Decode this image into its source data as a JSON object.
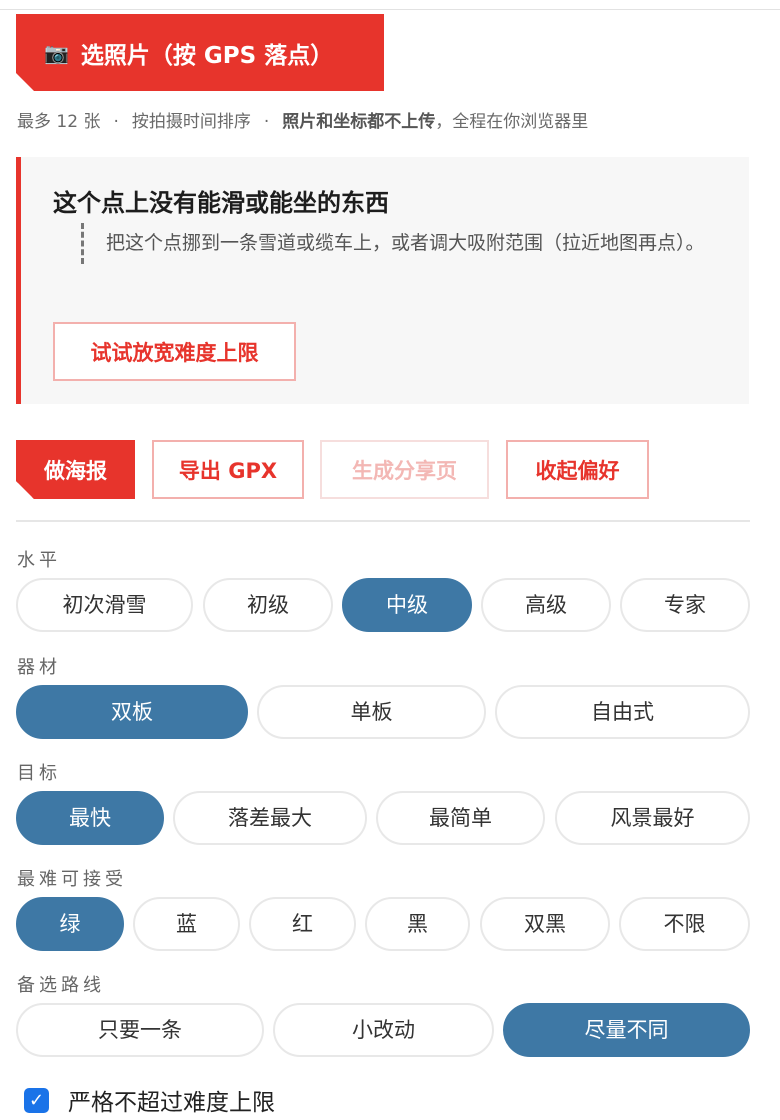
{
  "pick_photos": {
    "icon": "camera-icon",
    "icon_glyph": "📷",
    "label": "选照片（按 GPS 落点）"
  },
  "hint": {
    "limit": "最多 12 张",
    "sort": "按拍摄时间排序",
    "privacy_bold": "照片和坐标都不上传",
    "privacy_rest": "，全程在你浏览器里"
  },
  "warning": {
    "title": "这个点上没有能滑或能坐的东西",
    "body": "把这个点挪到一条雪道或缆车上，或者调大吸附范围（拉近地图再点）。",
    "action": "试试放宽难度上限"
  },
  "actions": {
    "poster": "做海报",
    "export_gpx": "导出 GPX",
    "share_page": "生成分享页",
    "collapse_prefs": "收起偏好"
  },
  "groups": {
    "level": {
      "label": "水平",
      "options": [
        "初次滑雪",
        "初级",
        "中级",
        "高级",
        "专家"
      ],
      "selected": "中级"
    },
    "gear": {
      "label": "器材",
      "options": [
        "双板",
        "单板",
        "自由式"
      ],
      "selected": "双板"
    },
    "goal": {
      "label": "目标",
      "options": [
        "最快",
        "落差最大",
        "最简单",
        "风景最好"
      ],
      "selected": "最快"
    },
    "max_difficulty": {
      "label": "最难可接受",
      "options": [
        "绿",
        "蓝",
        "红",
        "黑",
        "双黑",
        "不限"
      ],
      "selected": "绿"
    },
    "alternatives": {
      "label": "备选路线",
      "options": [
        "只要一条",
        "小改动",
        "尽量不同"
      ],
      "selected": "尽量不同"
    }
  },
  "strict_limit": {
    "label": "严格不超过难度上限",
    "checked": true
  },
  "colors": {
    "accent_red": "#e7342c",
    "selected_blue": "#3e78a5",
    "checkbox_blue": "#1a73e8"
  }
}
